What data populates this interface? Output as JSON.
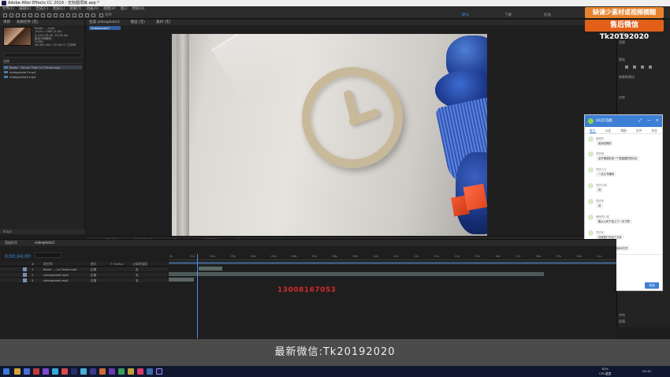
{
  "window": {
    "title": "Adobe After Effects CC 2019 - 无标题项目.aep *"
  },
  "menu": [
    "文件(F)",
    "编辑(E)",
    "合成(C)",
    "图层(L)",
    "效果(T)",
    "动画(A)",
    "视图(V)",
    "窗口",
    "帮助(H)"
  ],
  "toolbar": {
    "align_label": "对齐",
    "workspace_default": "默认",
    "workspace_learn": "了解",
    "workspace_standard": "标准"
  },
  "project": {
    "tabs": [
      "项目",
      "效果控件 (无)"
    ],
    "info_lines": [
      "Beats - ...mp4",
      "1920 x 1080 (1.00)",
      "Δ 0:00:33:20, 25.00 fps",
      "数百万种颜色",
      "H.264",
      "48.000 kHz / 32 bit U / 立体声"
    ],
    "column_name": "名称",
    "items": [
      "Beats - Sense Their Lo Times.mp4",
      "videophoto3.mp4",
      "videophoto4.mp4"
    ],
    "footer": "8 bpc"
  },
  "comp": {
    "tabs": [
      "合成 videophoto3",
      "图层 (无)",
      "素材 (无)"
    ],
    "subtab": "videophoto3",
    "view_zoom": "(73.6%)",
    "view_time": "0;00;00;00",
    "view_res": "完整",
    "view_camera": "活动摄像机",
    "view_count": "1个",
    "view_offset": "+0.0"
  },
  "right_panel": {
    "labels": [
      "信息",
      "音频",
      "预览",
      "效果和预设",
      "对齐",
      "段落",
      "字符"
    ]
  },
  "promo": {
    "line1": "缺课少素材或视频模糊",
    "line2": "售后微信 Tk20192020"
  },
  "chat": {
    "title": "QQ交流群",
    "tabs": [
      "聊天",
      "公告",
      "相册",
      "文件",
      "作业"
    ],
    "messages": [
      {
        "name": "管理员",
        "text": "老师讲得好"
      },
      {
        "name": "同学吴",
        "text": "这节课讲的是一个很重要的知识点"
      },
      {
        "name": "同学小王",
        "text": "一共几节课啊"
      },
      {
        "name": "同学小明",
        "text": "好"
      },
      {
        "name": "同学李",
        "text": "对"
      },
      {
        "name": "萌萌的小猫",
        "text": "刚从公司下班上了一半了啊"
      },
      {
        "name": "同学张",
        "text": "在哪里打开这个文件"
      },
      {
        "name": "回答者",
        "text": "把素材下载以后用AE打开"
      }
    ],
    "placeholder": "发消息给一下吧",
    "toggle_label": "禁止图片",
    "send_label": "发送"
  },
  "timeline": {
    "tabs": [
      "渲染队列",
      "videophoto3"
    ],
    "timecode": "0;00;04;00",
    "headers": {
      "num": "#",
      "name": "源名称",
      "mode": "模式",
      "trkmat": "T TrkMat",
      "parent": "父级和链接"
    },
    "layers": [
      {
        "num": "1",
        "name": "Beats - ...Lo Times.mp4",
        "mode": "正常",
        "parent": "无"
      },
      {
        "num": "2",
        "name": "videophoto3.mp4",
        "mode": "正常",
        "parent": "无"
      },
      {
        "num": "3",
        "name": "videophoto4.mp4",
        "mode": "正常",
        "parent": "无"
      }
    ],
    "ruler_ticks": [
      "0s",
      "01s",
      "02s",
      "03s",
      "04s",
      "05s",
      "06s",
      "07s",
      "08s",
      "09s",
      "10s",
      "11s",
      "12s",
      "13s",
      "14s",
      "15s",
      "16s",
      "17s",
      "18s",
      "19s",
      "20s",
      "21s"
    ]
  },
  "overlay": {
    "phone": "13008167053",
    "caption": "最新微信:Tk20192020"
  },
  "taskbar": {
    "tray_top": "62%",
    "tray_bottom": "CPU温度",
    "clock": "20:10"
  }
}
